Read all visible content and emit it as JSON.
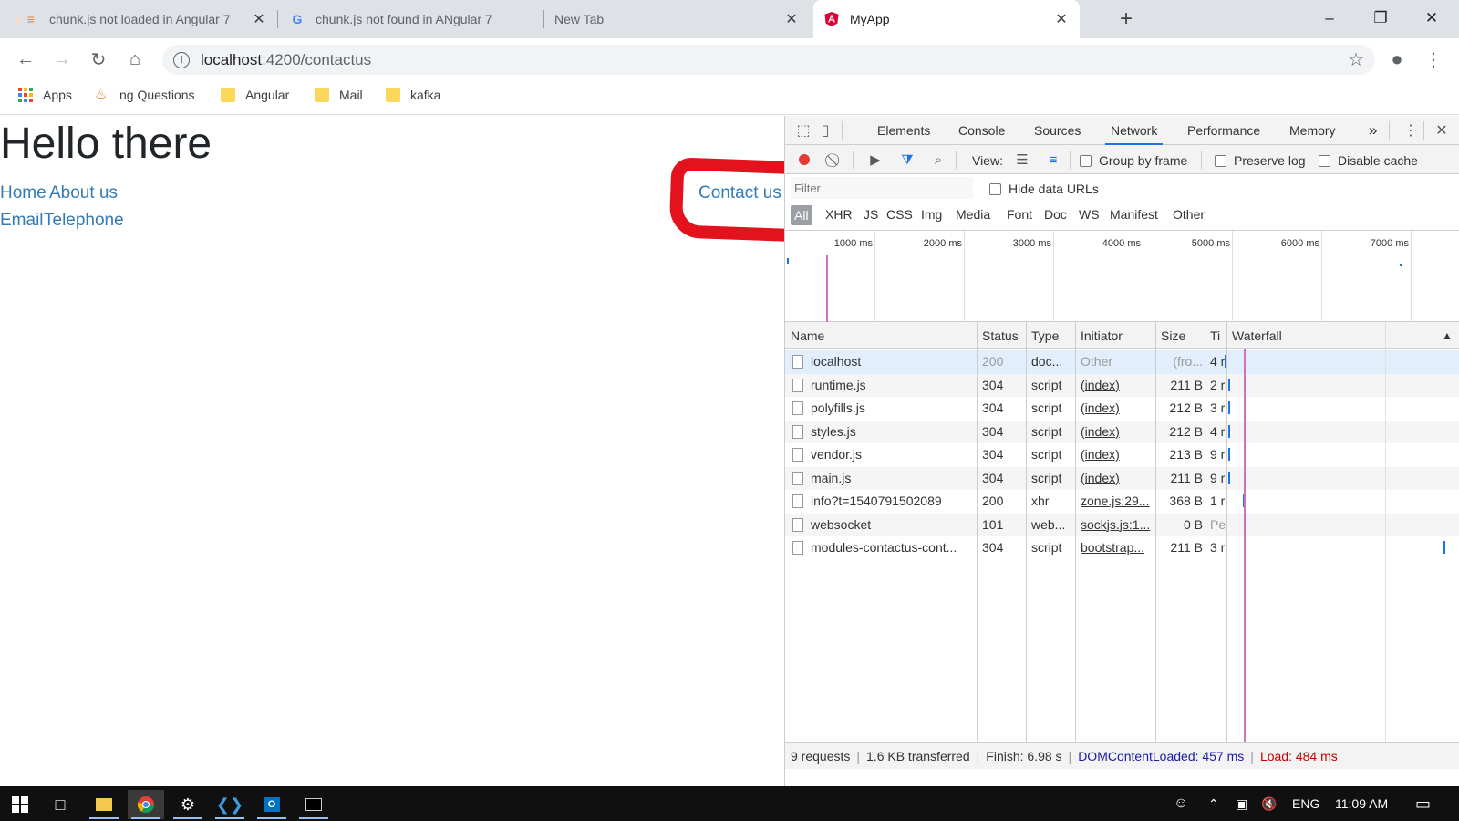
{
  "browser": {
    "tabs": [
      {
        "title": "chunk.js not loaded in Angular 7",
        "icon": "stackoverflow-icon"
      },
      {
        "title": "chunk.js not found in ANgular 7",
        "icon": "google-icon"
      },
      {
        "title": "New Tab",
        "icon": ""
      },
      {
        "title": "MyApp",
        "icon": "angular-icon",
        "active": true
      }
    ],
    "url_host": "localhost",
    "url_rest": ":4200/contactus",
    "bookmarks": [
      {
        "label": "Apps",
        "icon": "apps-grid-icon"
      },
      {
        "label": "ng Questions",
        "icon": "java-icon"
      },
      {
        "label": "Angular",
        "icon": "folder-icon"
      },
      {
        "label": "Mail",
        "icon": "folder-icon"
      },
      {
        "label": "kafka",
        "icon": "folder-icon"
      }
    ]
  },
  "page": {
    "heading": "Hello there",
    "links_row1": [
      "Home",
      "About us"
    ],
    "links_row2": [
      "Email",
      "Telephone"
    ],
    "contact_link": "Contact us"
  },
  "devtools": {
    "tabs": [
      "Elements",
      "Console",
      "Sources",
      "Network",
      "Performance",
      "Memory"
    ],
    "active_tab": "Network",
    "more_tabs": "»",
    "toolbar": {
      "view_label": "View:",
      "group_by_frame": "Group by frame",
      "preserve_log": "Preserve log",
      "disable_cache": "Disable cache"
    },
    "filter": {
      "placeholder": "Filter",
      "hide_data_urls": "Hide data URLs",
      "types": [
        "All",
        "XHR",
        "JS",
        "CSS",
        "Img",
        "Media",
        "Font",
        "Doc",
        "WS",
        "Manifest",
        "Other"
      ]
    },
    "overview_ticks": [
      "1000 ms",
      "2000 ms",
      "3000 ms",
      "4000 ms",
      "5000 ms",
      "6000 ms",
      "7000 ms"
    ],
    "columns": [
      "Name",
      "Status",
      "Type",
      "Initiator",
      "Size",
      "Ti",
      "Waterfall"
    ],
    "requests": [
      {
        "name": "localhost",
        "status": "200",
        "type": "doc...",
        "initiator": "Other",
        "size": "(fro...",
        "time": "4 r"
      },
      {
        "name": "runtime.js",
        "status": "304",
        "type": "script",
        "initiator": "(index)",
        "size": "211 B",
        "time": "2 r"
      },
      {
        "name": "polyfills.js",
        "status": "304",
        "type": "script",
        "initiator": "(index)",
        "size": "212 B",
        "time": "3 r"
      },
      {
        "name": "styles.js",
        "status": "304",
        "type": "script",
        "initiator": "(index)",
        "size": "212 B",
        "time": "4 r"
      },
      {
        "name": "vendor.js",
        "status": "304",
        "type": "script",
        "initiator": "(index)",
        "size": "213 B",
        "time": "9 r"
      },
      {
        "name": "main.js",
        "status": "304",
        "type": "script",
        "initiator": "(index)",
        "size": "211 B",
        "time": "9 r"
      },
      {
        "name": "info?t=1540791502089",
        "status": "200",
        "type": "xhr",
        "initiator": "zone.js:29...",
        "size": "368 B",
        "time": "1 r"
      },
      {
        "name": "websocket",
        "status": "101",
        "type": "web...",
        "initiator": "sockjs.js:1...",
        "size": "0 B",
        "time": "Pe"
      },
      {
        "name": "modules-contactus-cont...",
        "status": "304",
        "type": "script",
        "initiator": "bootstrap...",
        "size": "211 B",
        "time": "3 r"
      }
    ],
    "status": {
      "requests": "9 requests",
      "transferred": "1.6 KB transferred",
      "finish": "Finish: 6.98 s",
      "dcl": "DOMContentLoaded: 457 ms",
      "load": "Load: 484 ms"
    }
  },
  "taskbar": {
    "language": "ENG",
    "time": "11:09 AM"
  }
}
